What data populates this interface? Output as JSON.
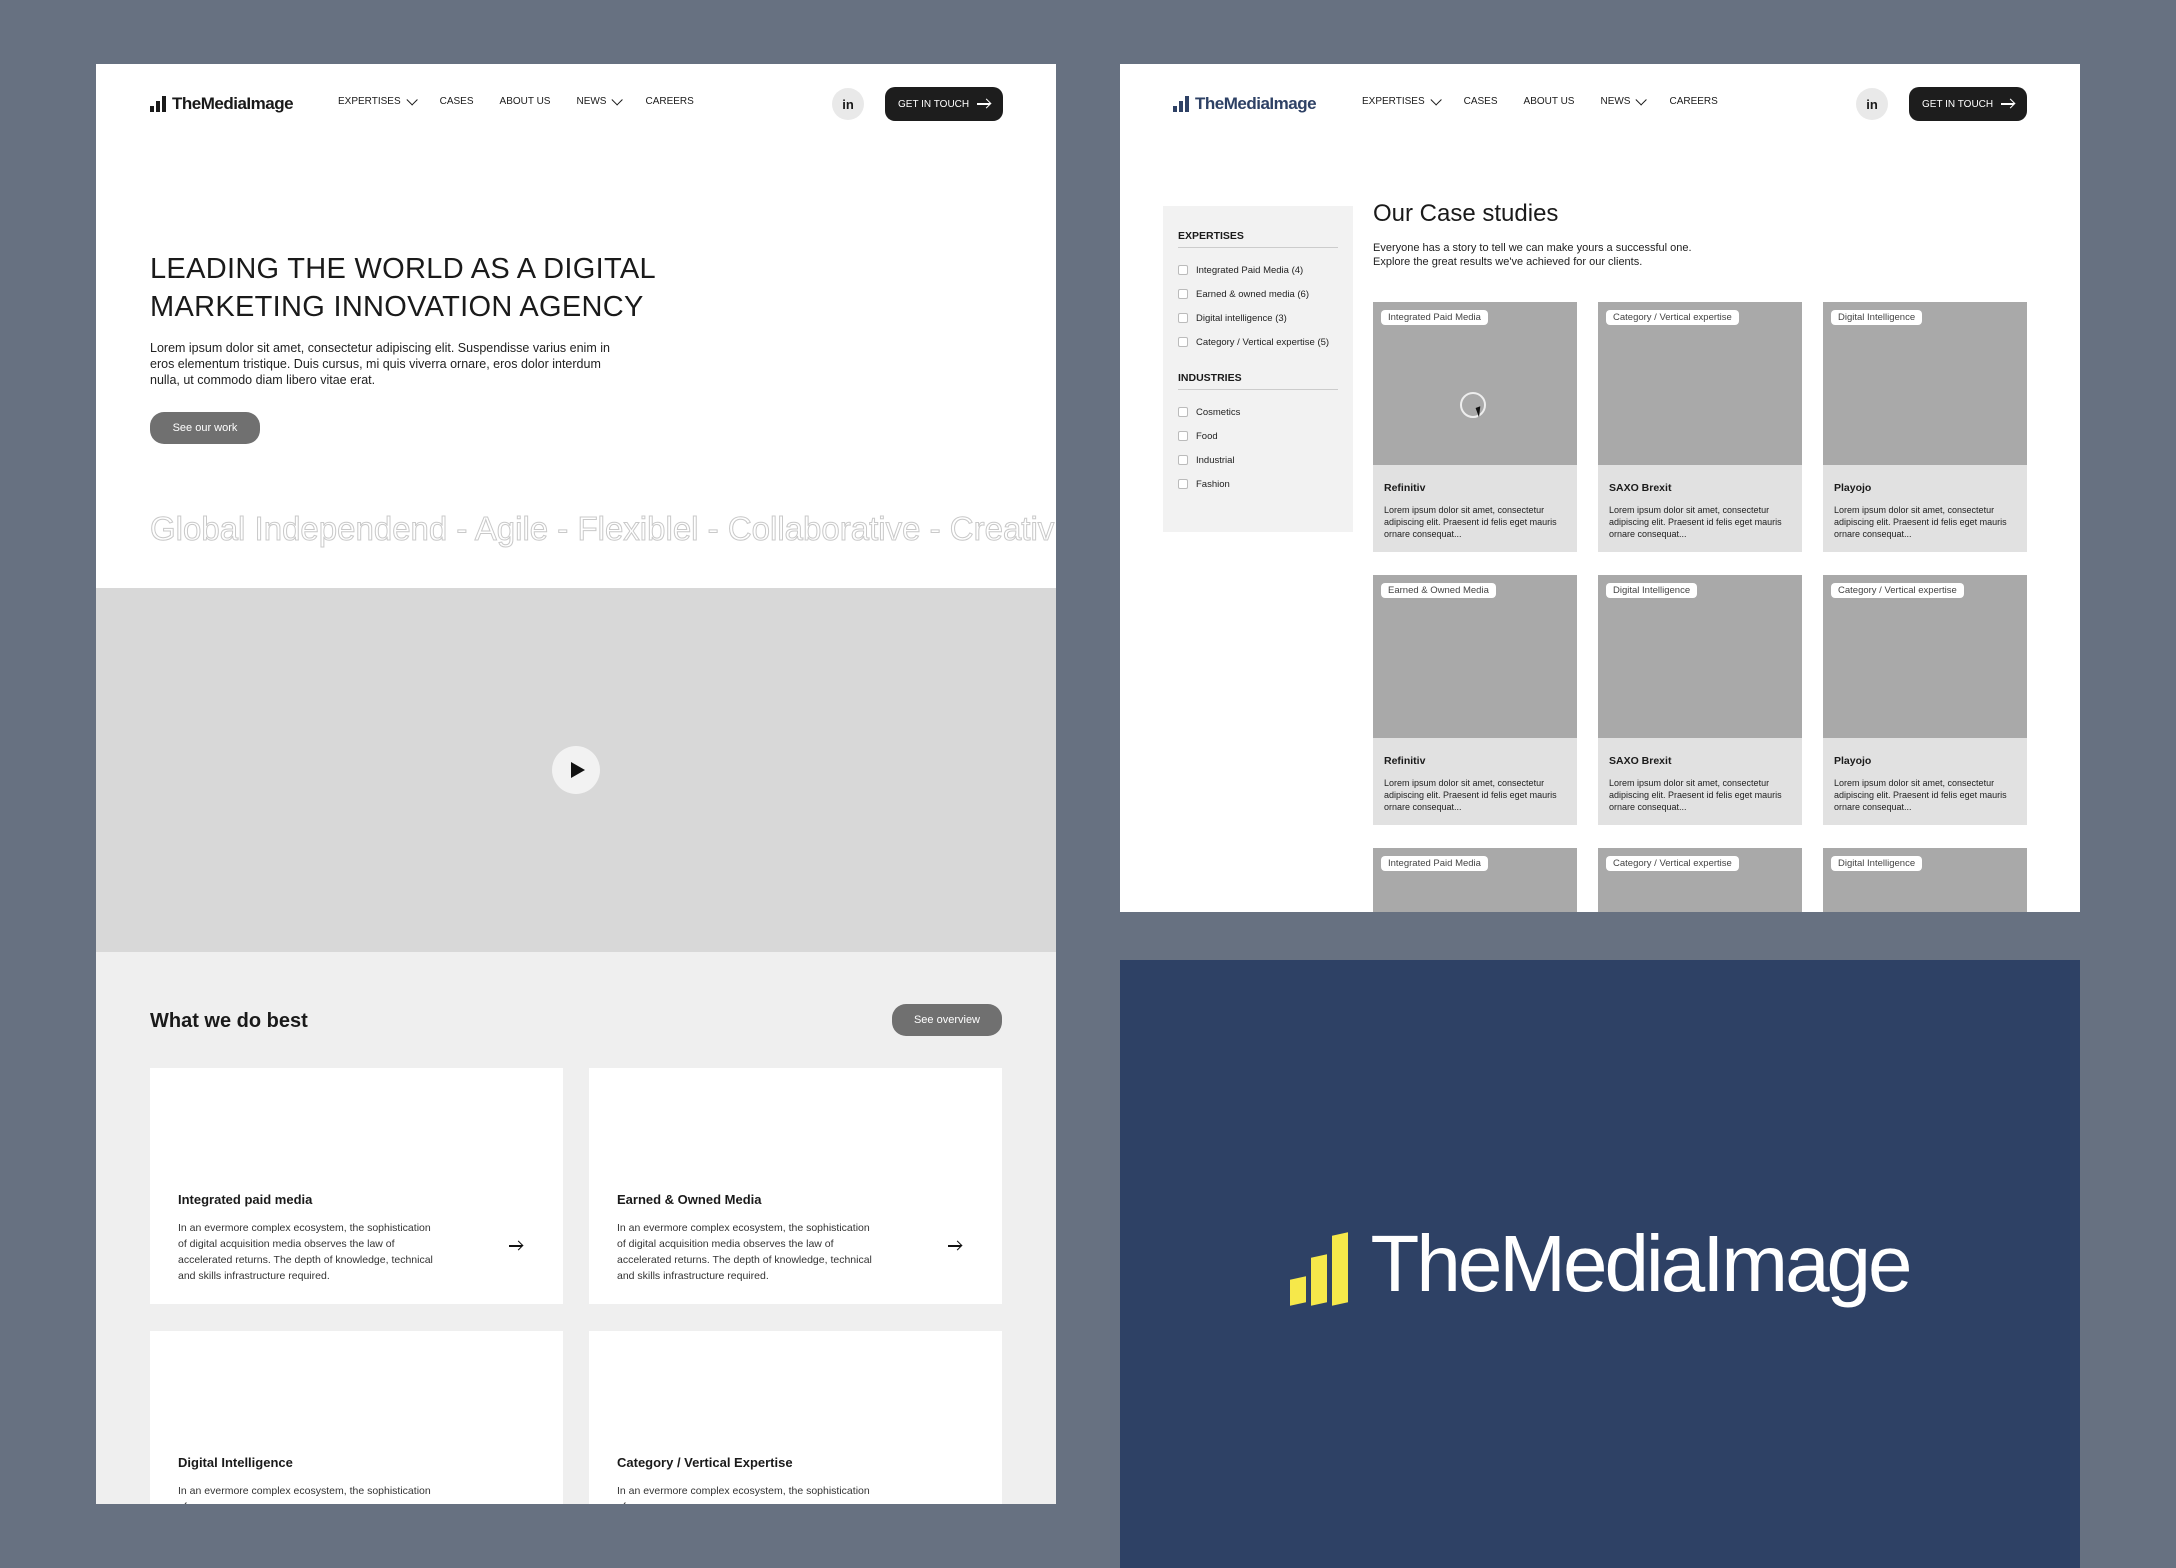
{
  "brand_name": "TheMediaImage",
  "nav": {
    "items": [
      "EXPERTISES",
      "CASES",
      "ABOUT US",
      "NEWS",
      "CAREERS"
    ],
    "linkedin": "in",
    "cta": "GET IN TOUCH"
  },
  "home": {
    "hero_title": "LEADING THE WORLD AS A DIGITAL MARKETING INNOVATION AGENCY",
    "hero_text": "Lorem ipsum dolor sit amet, consectetur adipiscing elit. Suspendisse varius enim in eros elementum tristique. Duis cursus, mi quis viverra ornare, eros dolor interdum nulla, ut commodo diam libero vitae erat.",
    "hero_button": "See our work",
    "ticker": "Global Independend - Agile - Flexiblel - Collaborative - Creativ",
    "section_title": "What we do best",
    "section_button": "See overview",
    "services": [
      {
        "title": "Integrated paid media",
        "text": "In an evermore complex ecosystem, the sophistication of digital acquisition media observes the law of accelerated returns. The depth of knowledge, technical and skills infrastructure required."
      },
      {
        "title": "Earned & Owned Media",
        "text": "In an evermore complex ecosystem, the sophistication of digital acquisition media observes the law of accelerated returns. The depth of knowledge, technical and skills infrastructure required."
      },
      {
        "title": "Digital Intelligence",
        "text": "In an evermore complex ecosystem, the sophistication of"
      },
      {
        "title": "Category / Vertical Expertise",
        "text": "In an evermore complex ecosystem, the sophistication of"
      }
    ]
  },
  "cases": {
    "title": "Our Case studies",
    "subtitle": "Everyone has a story to tell we can make yours a successful one. Explore the great results we've achieved for our clients.",
    "filters": {
      "expertises_label": "EXPERTISES",
      "expertises": [
        "Integrated Paid Media  (4)",
        "Earned & owned media (6)",
        "Digital intelligence (3)",
        "Category / Vertical expertise (5)"
      ],
      "industries_label": "INDUSTRIES",
      "industries": [
        "Cosmetics",
        "Food",
        "Industrial",
        "Fashion"
      ]
    },
    "cards": [
      {
        "tag": "Integrated Paid Media",
        "name": "Refinitiv",
        "desc": "Lorem ipsum dolor sit amet, consectetur adipiscing elit. Praesent id felis eget mauris ornare consequat..."
      },
      {
        "tag": "Category / Vertical expertise",
        "name": "SAXO Brexit",
        "desc": "Lorem ipsum dolor sit amet, consectetur adipiscing elit. Praesent id felis eget mauris ornare consequat..."
      },
      {
        "tag": "Digital Intelligence",
        "name": "Playojo",
        "desc": "Lorem ipsum dolor sit amet, consectetur adipiscing elit. Praesent id felis eget mauris ornare consequat..."
      },
      {
        "tag": "Earned & Owned Media",
        "name": "Refinitiv",
        "desc": "Lorem ipsum dolor sit amet, consectetur adipiscing elit. Praesent id felis eget mauris ornare consequat..."
      },
      {
        "tag": "Digital Intelligence",
        "name": "SAXO Brexit",
        "desc": "Lorem ipsum dolor sit amet, consectetur adipiscing elit. Praesent id felis eget mauris ornare consequat..."
      },
      {
        "tag": "Category / Vertical expertise",
        "name": "Playojo",
        "desc": "Lorem ipsum dolor sit amet, consectetur adipiscing elit. Praesent id felis eget mauris ornare consequat..."
      },
      {
        "tag": "Integrated Paid Media",
        "name": "",
        "desc": ""
      },
      {
        "tag": "Category / Vertical expertise",
        "name": "",
        "desc": ""
      },
      {
        "tag": "Digital Intelligence",
        "name": "",
        "desc": ""
      }
    ]
  },
  "colors": {
    "background": "#677181",
    "brand_navy": "#2e4165",
    "brand_yellow": "#f6e84a"
  }
}
